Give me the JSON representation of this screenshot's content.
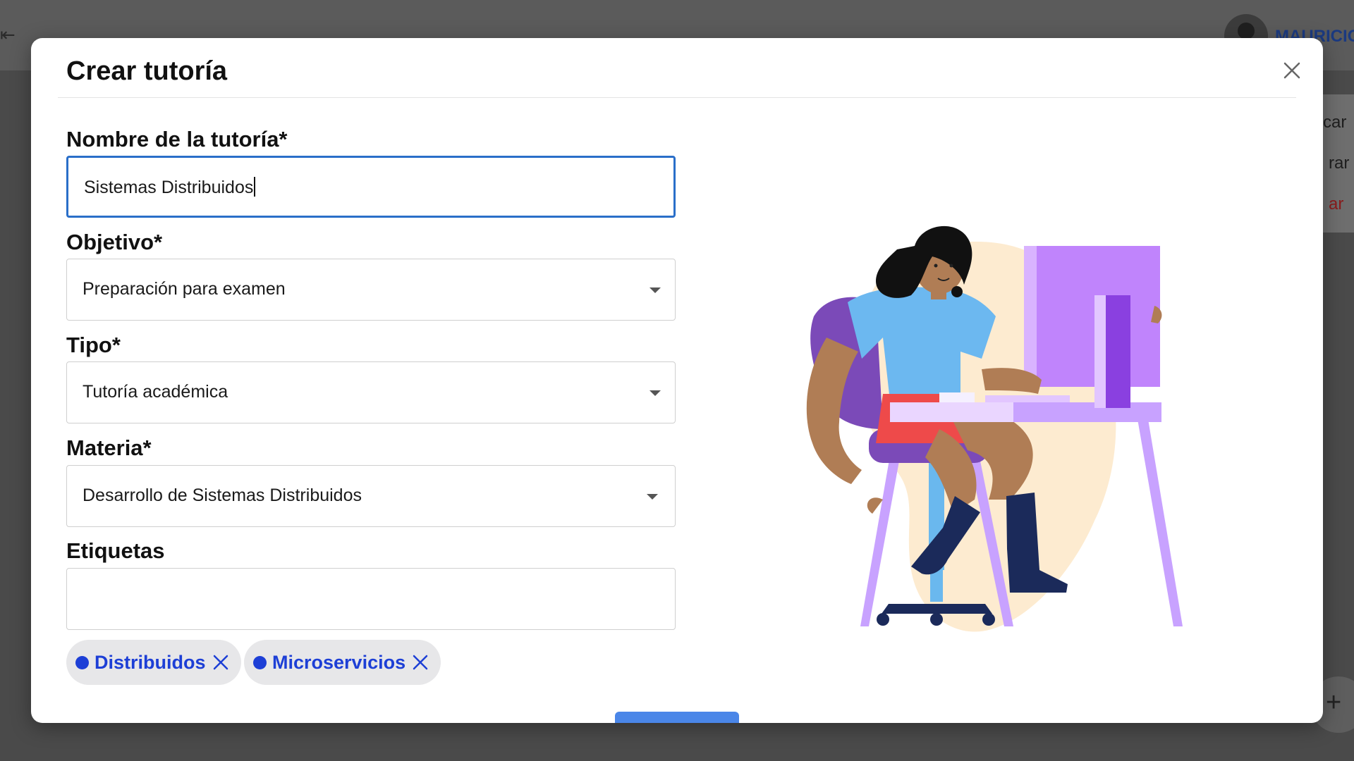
{
  "background": {
    "back_icon_glyph": "⇤",
    "user_name": "MAURICIO",
    "menu_items": [
      "car",
      "rar",
      "ar"
    ],
    "fab_glyph": "+"
  },
  "modal": {
    "title": "Crear tutoría",
    "close_icon": "close-icon",
    "fields": {
      "name": {
        "label": "Nombre de la tutoría*",
        "value": "Sistemas Distribuidos"
      },
      "objective": {
        "label": "Objetivo*",
        "value": "Preparación para examen"
      },
      "type": {
        "label": "Tipo*",
        "value": "Tutoría académica"
      },
      "subject": {
        "label": "Materia*",
        "value": "Desarrollo de Sistemas Distribuidos"
      },
      "tags": {
        "label": "Etiquetas",
        "value": ""
      }
    },
    "tags": [
      {
        "label": "Distribuidos"
      },
      {
        "label": "Microservicios"
      }
    ]
  },
  "colors": {
    "focus_border": "#2a6fc9",
    "tag_accent": "#1d3fd6",
    "submit_button": "#4a86e8"
  }
}
